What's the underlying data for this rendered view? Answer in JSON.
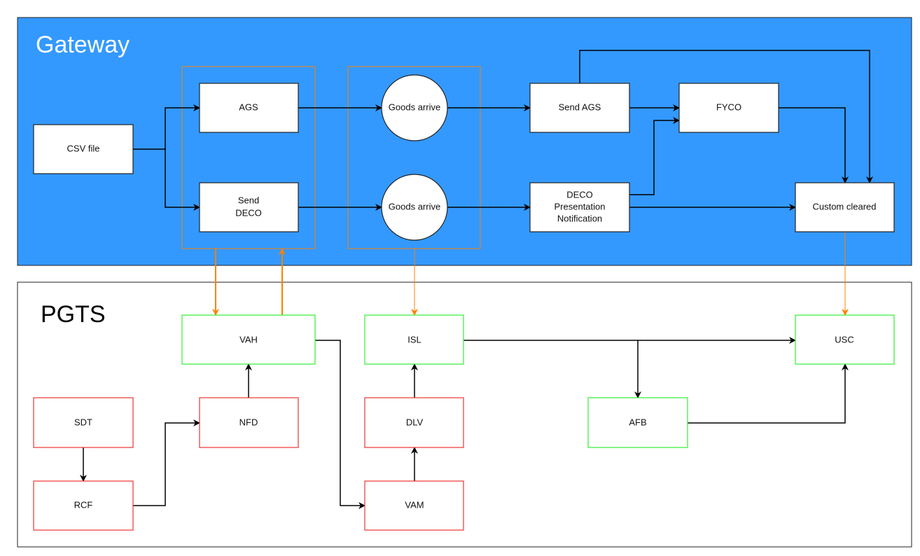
{
  "colors": {
    "gateway_bg": "#3399FF",
    "orange": "#FF8000",
    "green": "#33EE33",
    "red": "#EE3333"
  },
  "gateway": {
    "title": "Gateway",
    "nodes": {
      "csv": "CSV file",
      "ags": "AGS",
      "send_deco": [
        "Send",
        "DECO"
      ],
      "goods1": "Goods arrive",
      "goods2": "Goods arrive",
      "send_ags": "Send AGS",
      "fyco": "FYCO",
      "deco_pres": [
        "DECO",
        "Presentation",
        "Notification"
      ],
      "custom": "Custom cleared"
    }
  },
  "pgts": {
    "title": "PGTS",
    "nodes": {
      "vah": "VAH",
      "isl": "ISL",
      "usc": "USC",
      "sdt": "SDT",
      "nfd": "NFD",
      "dlv": "DLV",
      "afb": "AFB",
      "rcf": "RCF",
      "vam": "VAM"
    }
  }
}
